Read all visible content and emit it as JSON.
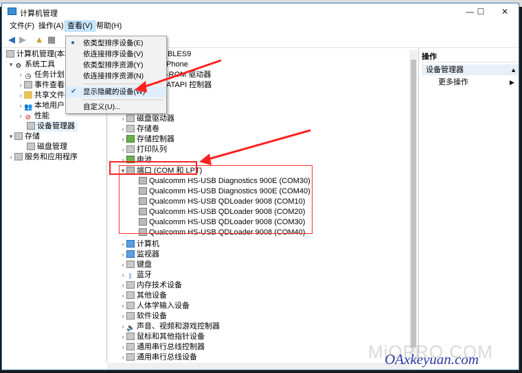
{
  "window": {
    "title": "计算机管理",
    "minimize": "—",
    "maximize": "☐",
    "close": "✕"
  },
  "menubar": {
    "file": "文件(F)",
    "action": "操作(A)",
    "view": "查看(V)",
    "help": "帮助(H)"
  },
  "view_menu": {
    "items": [
      "依类型排序设备(E)",
      "依连接排序设备(V)",
      "依类型排序资源(Y)",
      "依连接排序资源(N)",
      "显示隐藏的设备(W)",
      "自定义(U)..."
    ],
    "selected_index": 0,
    "checked_index": 4
  },
  "left_tree": [
    "计算机管理(本地)",
    "系统工具",
    "任务计划",
    "事件查看器",
    "共享文件夹",
    "本地用户",
    "性能",
    "设备管理器",
    "存储",
    "磁盘管理",
    "服务和应用程序"
  ],
  "device_tree": {
    "computer_partial": "RBLES9",
    "top_partial": [
      "Phone",
      "-ROM 驱动器",
      "ATAPI 控制器"
    ],
    "categories_before": [
      "磁盘驱动器",
      "存储卷",
      "存储控制器",
      "打印队列",
      "电池"
    ],
    "ports_label": "端口 (COM 和 LPT)",
    "ports": [
      "Qualcomm HS-USB Diagnostics 900E (COM30)",
      "Qualcomm HS-USB Diagnostics 900E (COM40)",
      "Qualcomm HS-USB QDLoader 9008 (COM10)",
      "Qualcomm HS-USB QDLoader 9008 (COM20)",
      "Qualcomm HS-USB QDLoader 9008 (COM30)",
      "Qualcomm HS-USB QDLoader 9008 (COM40)"
    ],
    "categories_after": [
      "计算机",
      "监视器",
      "键盘",
      "蓝牙",
      "内存技术设备",
      "其他设备",
      "人体学输入设备",
      "软件设备",
      "声音、视频和游戏控制器",
      "鼠标和其他指针设备",
      "通用串行总线控制器",
      "通用串行总线设备"
    ]
  },
  "actions_pane": {
    "header": "操作",
    "section": "设备管理器",
    "more": "更多操作"
  },
  "watermarks": {
    "miopro": "MiOPRO.COM",
    "oax": "OAxkeyuan.com"
  }
}
